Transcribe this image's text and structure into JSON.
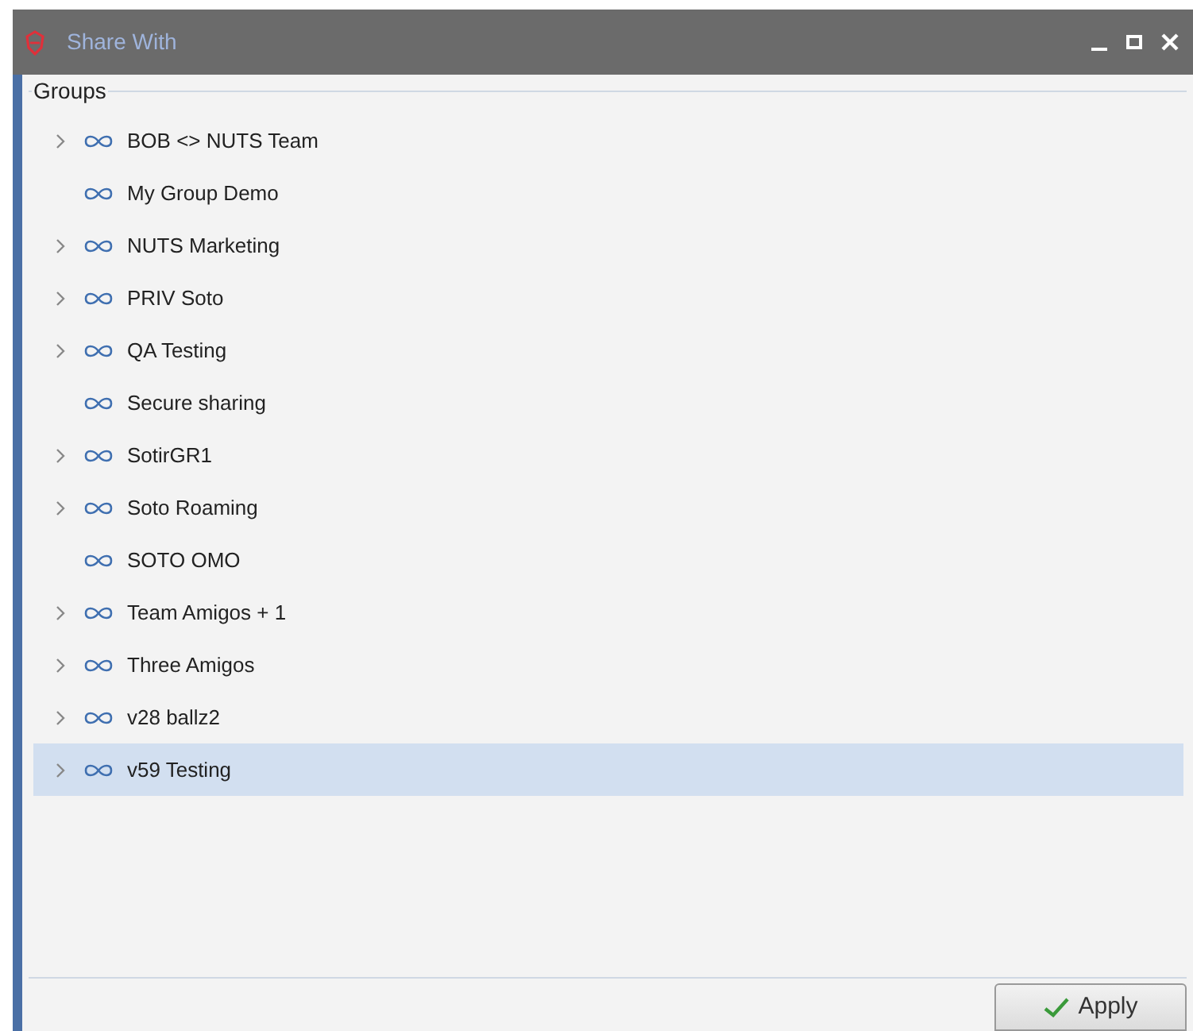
{
  "window": {
    "title": "Share With"
  },
  "groups": {
    "label": "Groups",
    "items": [
      {
        "name": "BOB <> NUTS Team",
        "expandable": true,
        "selected": false
      },
      {
        "name": "My Group Demo",
        "expandable": false,
        "selected": false
      },
      {
        "name": "NUTS Marketing",
        "expandable": true,
        "selected": false
      },
      {
        "name": "PRIV Soto",
        "expandable": true,
        "selected": false
      },
      {
        "name": "QA Testing",
        "expandable": true,
        "selected": false
      },
      {
        "name": "Secure sharing",
        "expandable": false,
        "selected": false
      },
      {
        "name": "SotirGR1",
        "expandable": true,
        "selected": false
      },
      {
        "name": "Soto Roaming",
        "expandable": true,
        "selected": false
      },
      {
        "name": "SOTO OMO",
        "expandable": false,
        "selected": false
      },
      {
        "name": "Team Amigos + 1",
        "expandable": true,
        "selected": false
      },
      {
        "name": "Three Amigos",
        "expandable": true,
        "selected": false
      },
      {
        "name": "v28 ballz2",
        "expandable": true,
        "selected": false
      },
      {
        "name": "v59 Testing",
        "expandable": true,
        "selected": true
      }
    ]
  },
  "apply_button": {
    "label": "Apply"
  }
}
